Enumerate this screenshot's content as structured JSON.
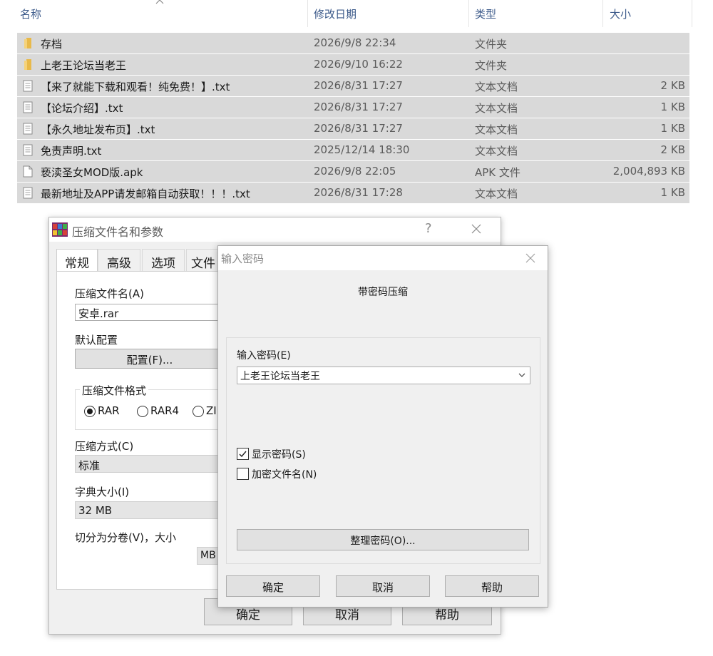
{
  "explorer": {
    "columns": {
      "name": "名称",
      "date": "修改日期",
      "type": "类型",
      "size": "大小"
    },
    "rows": [
      {
        "icon": "folder-icon",
        "name": "存档",
        "date": "2026/9/8 22:34",
        "type": "文件夹",
        "size": ""
      },
      {
        "icon": "folder-icon",
        "name": "上老王论坛当老王",
        "date": "2026/9/10 16:22",
        "type": "文件夹",
        "size": ""
      },
      {
        "icon": "text-file-icon",
        "name": "【来了就能下载和观看！纯免费！】.txt",
        "date": "2026/8/31 17:27",
        "type": "文本文档",
        "size": "2 KB"
      },
      {
        "icon": "text-file-icon",
        "name": "【论坛介绍】.txt",
        "date": "2026/8/31 17:27",
        "type": "文本文档",
        "size": "1 KB"
      },
      {
        "icon": "text-file-icon",
        "name": "【永久地址发布页】.txt",
        "date": "2026/8/31 17:27",
        "type": "文本文档",
        "size": "1 KB"
      },
      {
        "icon": "text-file-icon",
        "name": "免责声明.txt",
        "date": "2025/12/14 18:30",
        "type": "文本文档",
        "size": "2 KB"
      },
      {
        "icon": "file-icon",
        "name": "亵渎圣女MOD版.apk",
        "date": "2026/9/8 22:05",
        "type": "APK 文件",
        "size": "2,004,893 KB"
      },
      {
        "icon": "text-file-icon",
        "name": "最新地址及APP请发邮箱自动获取！！！.txt",
        "date": "2026/8/31 17:28",
        "type": "文本文档",
        "size": "1 KB"
      }
    ]
  },
  "archive_dialog": {
    "title": "压缩文件名和参数",
    "help_glyph": "?",
    "tabs": [
      "常规",
      "高级",
      "选项",
      "文件"
    ],
    "archive_name_label": "压缩文件名(A)",
    "archive_name_value": "安卓.rar",
    "default_profile_label": "默认配置",
    "profile_button": "配置(F)...",
    "format_group_label": "压缩文件格式",
    "format_options": [
      "RAR",
      "RAR4",
      "ZI"
    ],
    "method_label": "压缩方式(C)",
    "method_value": "标准",
    "dict_label": "字典大小(I)",
    "dict_value": "32 MB",
    "split_label": "切分为分卷(V)，大小",
    "split_unit": "MB",
    "ok": "确定",
    "cancel": "取消",
    "help": "帮助"
  },
  "password_dialog": {
    "title": "输入密码",
    "heading": "带密码压缩",
    "password_label": "输入密码(E)",
    "password_value": "上老王论坛当老王",
    "show_password_label": "显示密码(S)",
    "show_password_checked": true,
    "encrypt_names_label": "加密文件名(N)",
    "encrypt_names_checked": false,
    "organize_button": "整理密码(O)...",
    "ok": "确定",
    "cancel": "取消",
    "help": "帮助"
  },
  "colors": {
    "selection_bg": "#d9d9d9",
    "header_text": "#3c5a8a",
    "folder": "#e8b94a",
    "dialog_bg": "#f0f0f0"
  }
}
